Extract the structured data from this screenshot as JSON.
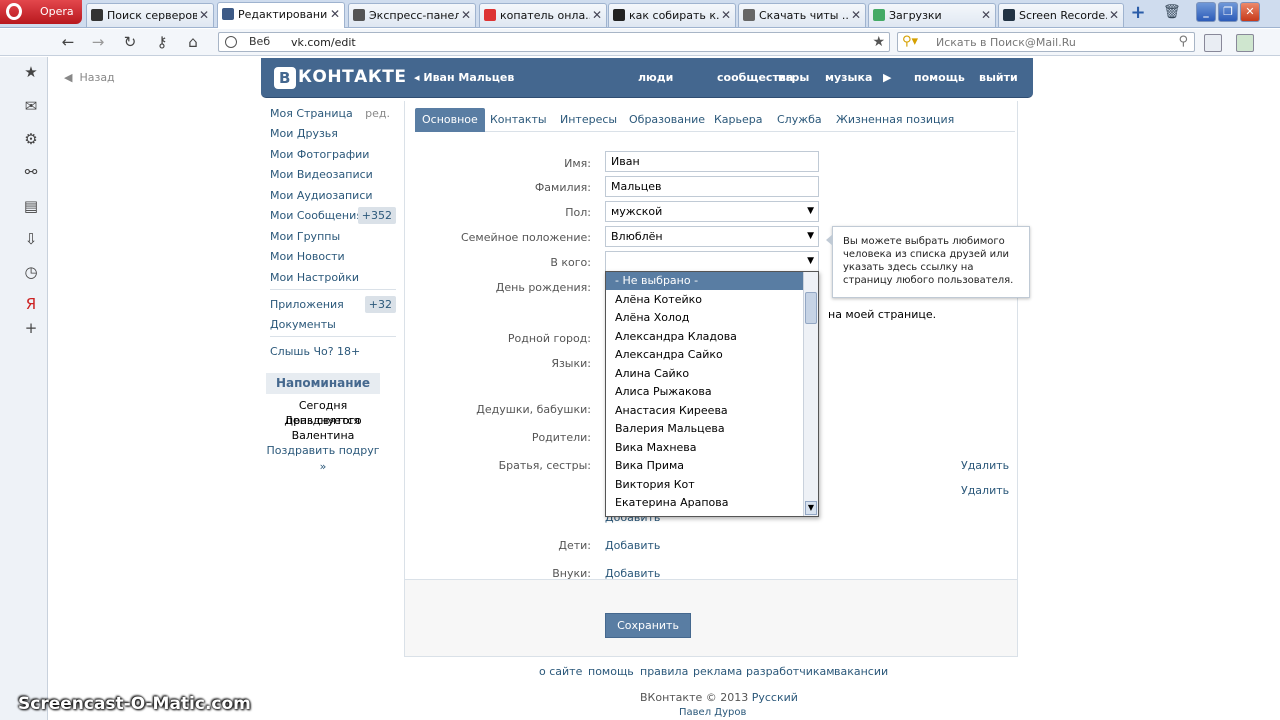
{
  "browser": {
    "opera_label": "Opera",
    "tabs": [
      {
        "title": "Поиск серверов..."
      },
      {
        "title": "Редактировани..."
      },
      {
        "title": "Экспресс-панель"
      },
      {
        "title": "копатель онла..."
      },
      {
        "title": "как собирать к..."
      },
      {
        "title": "Скачать читы ..."
      },
      {
        "title": "Загрузки"
      },
      {
        "title": "Screen Recorde..."
      }
    ],
    "address_badge": "Веб",
    "address": "vk.com/edit",
    "search_placeholder": "Искать в Поиск@Mail.Ru"
  },
  "page": {
    "back": "Назад",
    "header": {
      "logo": "КОНТАКТЕ",
      "logo_letter": "В",
      "user": "Иван Мальцев",
      "nav": [
        "люди",
        "сообщества",
        "игры",
        "музыка",
        "помощь",
        "выйти"
      ]
    },
    "left_menu": {
      "items": [
        {
          "label": "Моя Страница",
          "extra": "ред."
        },
        {
          "label": "Мои Друзья"
        },
        {
          "label": "Мои Фотографии"
        },
        {
          "label": "Мои Видеозаписи"
        },
        {
          "label": "Мои Аудиозаписи"
        },
        {
          "label": "Мои Сообщения",
          "badge": "+352"
        },
        {
          "label": "Мои Группы"
        },
        {
          "label": "Мои Новости"
        },
        {
          "label": "Мои Настройки"
        }
      ],
      "apps": {
        "label": "Приложения",
        "badge": "+32"
      },
      "docs": "Документы",
      "extra": "Слышь Чо? 18+",
      "reminder": {
        "title": "Напоминание",
        "lines": [
          "Сегодня празднуется",
          "День святого",
          "Валентина"
        ],
        "link": "Поздравить подруг »"
      }
    },
    "tabs": [
      "Основное",
      "Контакты",
      "Интересы",
      "Образование",
      "Карьера",
      "Служба",
      "Жизненная позиция"
    ],
    "form": {
      "name_label": "Имя:",
      "name_value": "Иван",
      "surname_label": "Фамилия:",
      "surname_value": "Мальцев",
      "gender_label": "Пол:",
      "gender_value": "мужской",
      "family_label": "Семейное положение:",
      "family_value": "Влюблён",
      "partner_label": "В кого:",
      "birthday_label": "День рождения:",
      "birthday_note": "на моей странице.",
      "hometown_label": "Родной город:",
      "languages_label": "Языки:",
      "grandparents_label": "Дедушки, бабушки:",
      "parents_label": "Родители:",
      "siblings_label": "Братья, сестры:",
      "delete_label": "Удалить",
      "add_label": "Добавить",
      "children_label": "Дети:",
      "grandchildren_label": "Внуки:",
      "save_label": "Сохранить"
    },
    "tooltip": "Вы можете выбрать любимого человека из списка друзей или указать здесь ссылку на страницу любого пользователя.",
    "dropdown": [
      "- Не выбрано -",
      "Алёна Котейко",
      "Алёна Холод",
      "Александра Кладова",
      "Александра Сайко",
      "Алина Сайко",
      "Алиса Рыжакова",
      "Анастасия Киреева",
      "Валерия Мальцева",
      "Вика Махнева",
      "Вика Прима",
      "Виктория Кот",
      "Екатерина Арапова"
    ],
    "footer": {
      "links": [
        "о сайте",
        "помощь",
        "правила",
        "реклама",
        "разработчикам",
        "вакансии"
      ],
      "copyright": "ВКонтакте © 2013",
      "language": "Русский",
      "author": "Павел Дуров"
    }
  },
  "watermark": "Screencast-O-Matic.com",
  "colors": {
    "vk_blue": "#44678f",
    "link": "#2b587a",
    "selected": "#597da3"
  }
}
